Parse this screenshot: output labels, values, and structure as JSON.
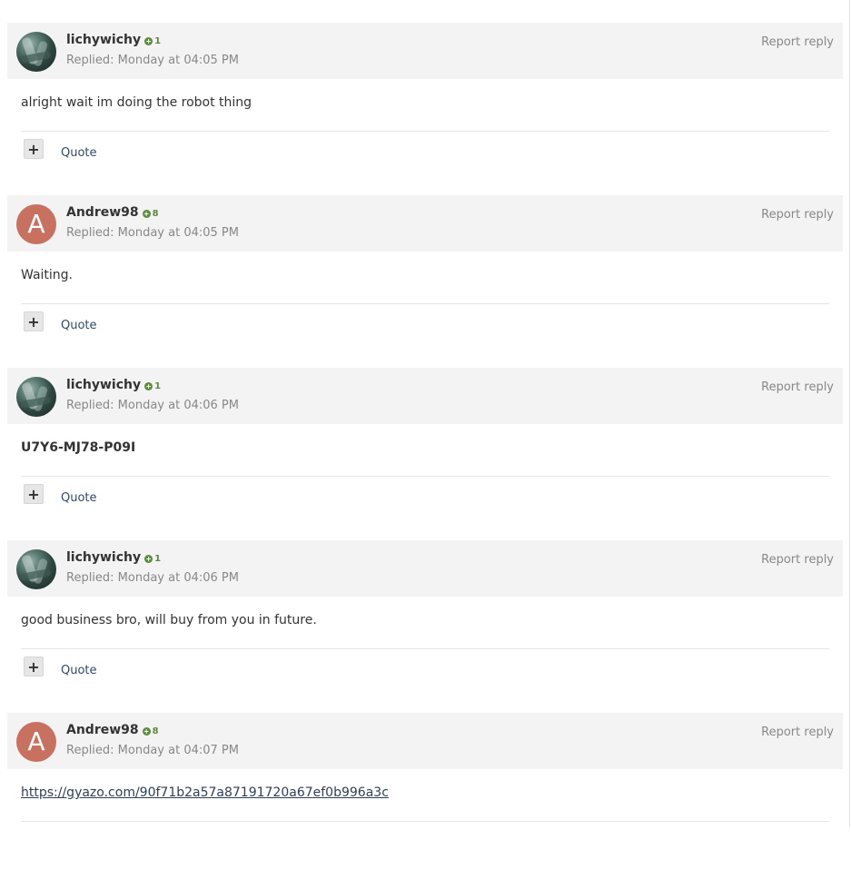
{
  "posts": [
    {
      "author": "lichywichy",
      "reputation": "1",
      "avatar": "photo",
      "replied": "Replied: Monday at 04:05 PM",
      "report": "Report reply",
      "content": "alright wait im doing the robot thing",
      "content_style": "normal",
      "plus": "+",
      "quote": "Quote"
    },
    {
      "author": "Andrew98",
      "reputation": "8",
      "avatar": "A",
      "replied": "Replied: Monday at 04:05 PM",
      "report": "Report reply",
      "content": "Waiting.",
      "content_style": "normal",
      "plus": "+",
      "quote": "Quote"
    },
    {
      "author": "lichywichy",
      "reputation": "1",
      "avatar": "photo",
      "replied": "Replied: Monday at 04:06 PM",
      "report": "Report reply",
      "content": "U7Y6-MJ78-P09I",
      "content_style": "bold",
      "plus": "+",
      "quote": "Quote"
    },
    {
      "author": "lichywichy",
      "reputation": "1",
      "avatar": "photo",
      "replied": "Replied: Monday at 04:06 PM",
      "report": "Report reply",
      "content": "good business bro, will buy from you in future.",
      "content_style": "normal",
      "plus": "+",
      "quote": "Quote"
    },
    {
      "author": "Andrew98",
      "reputation": "8",
      "avatar": "A",
      "replied": "Replied: Monday at 04:07 PM",
      "report": "Report reply",
      "content": "https://gyazo.com/90f71b2a57a87191720a67ef0b996a3c",
      "content_style": "link",
      "plus": "+",
      "quote": "Quote"
    }
  ],
  "colors": {
    "header_bg": "#f3f3f3",
    "reputation_green": "#5a8a3a",
    "avatar_letter_bg": "#c97161",
    "quote_link": "#2f4a6e"
  },
  "icons": {
    "reputation": "plus-circle-icon",
    "plus_button": "plus-icon"
  }
}
